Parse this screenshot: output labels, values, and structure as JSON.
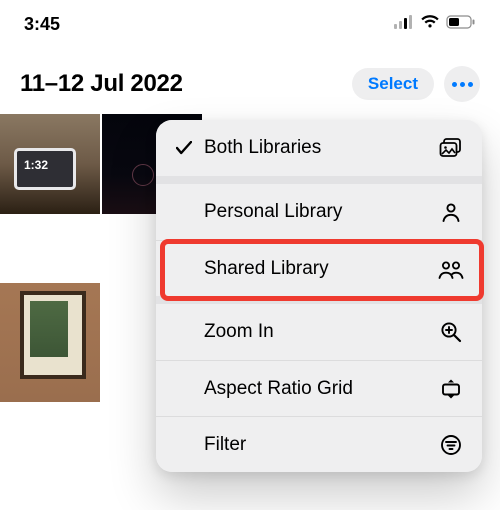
{
  "status": {
    "time": "3:45",
    "thumb_time": "1:32"
  },
  "header": {
    "date_title": "11–12 Jul 2022",
    "select_label": "Select"
  },
  "menu": {
    "both": "Both Libraries",
    "personal": "Personal Library",
    "shared": "Shared Library",
    "zoom": "Zoom In",
    "aspect": "Aspect Ratio Grid",
    "filter": "Filter"
  }
}
